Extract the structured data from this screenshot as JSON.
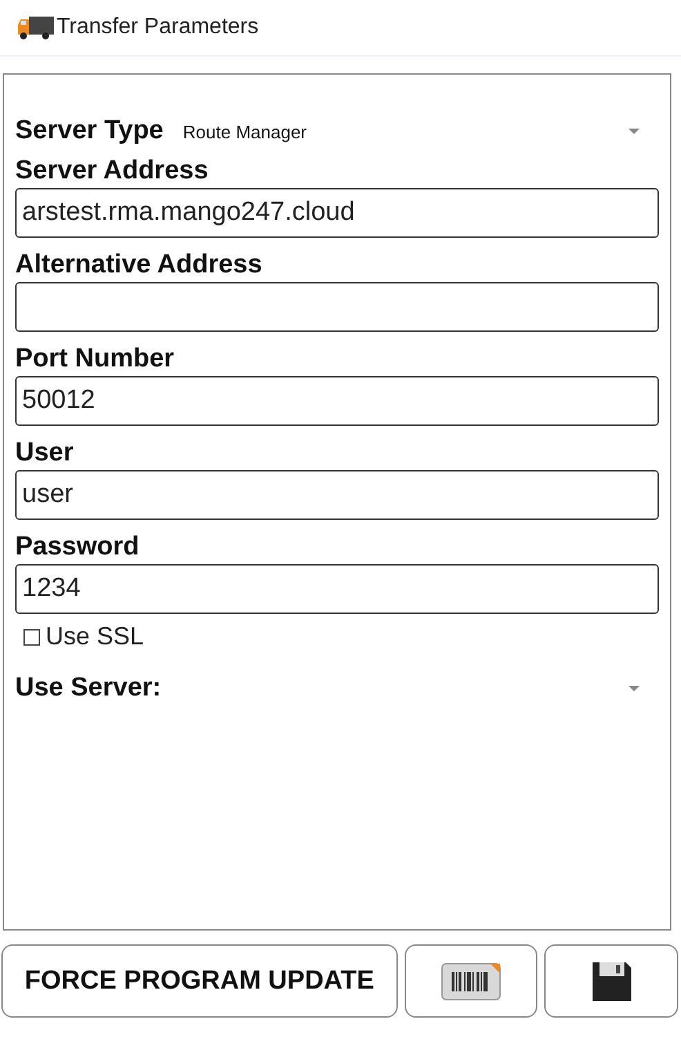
{
  "window": {
    "title": "Transfer Parameters"
  },
  "fields": [
    {
      "kind": "select",
      "label": "Server Type",
      "value": "Route Manager"
    },
    {
      "kind": "input",
      "label": "Server Address",
      "value": "arstest.rma.mango247.cloud"
    },
    {
      "kind": "input",
      "label": "Alternative Address"
    },
    {
      "kind": "input",
      "label": "Port Number",
      "value": "50012"
    },
    {
      "kind": "input",
      "label": "User",
      "value": "user"
    },
    {
      "kind": "input",
      "label": "Password",
      "value": "1234"
    },
    {
      "kind": "checkbox",
      "label": "Use SSL",
      "checked": false
    },
    {
      "kind": "select",
      "label": "Use Server:"
    }
  ],
  "buttons": [
    {
      "kind": "text",
      "label": "FORCE PROGRAM UPDATE"
    },
    {
      "kind": "barcode"
    },
    {
      "kind": "save"
    }
  ]
}
